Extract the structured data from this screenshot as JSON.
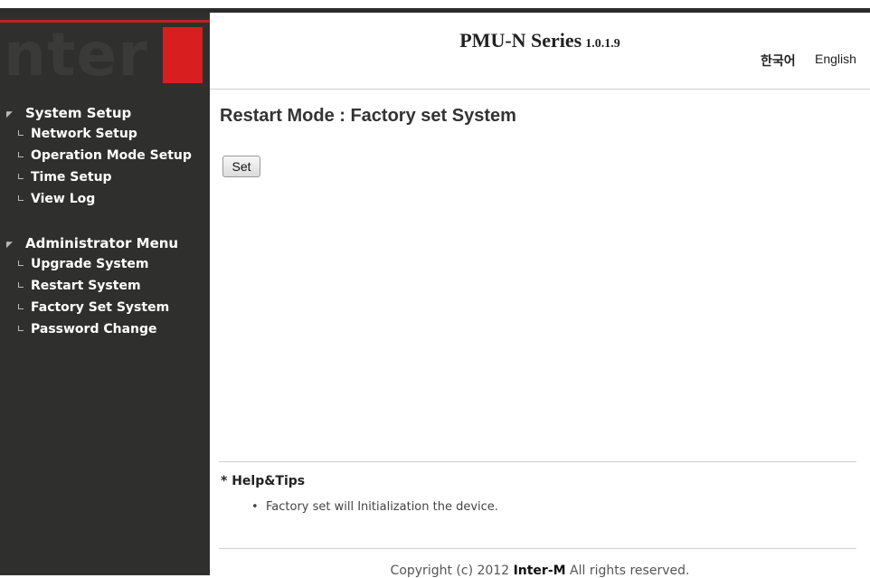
{
  "header": {
    "title": "PMU-N Series",
    "version": "1.0.1.9",
    "lang_ko": "한국어",
    "lang_en": "English"
  },
  "logo": {
    "text": "nter"
  },
  "sidebar": {
    "groups": [
      {
        "label": "System Setup",
        "items": [
          {
            "label": "Network Setup"
          },
          {
            "label": "Operation Mode Setup"
          },
          {
            "label": "Time Setup"
          },
          {
            "label": "View Log"
          }
        ]
      },
      {
        "label": "Administrator Menu",
        "items": [
          {
            "label": "Upgrade System"
          },
          {
            "label": "Restart System"
          },
          {
            "label": "Factory Set System"
          },
          {
            "label": "Password Change"
          }
        ]
      }
    ]
  },
  "main": {
    "title": "Restart Mode : Factory set System",
    "set_button": "Set"
  },
  "help": {
    "title": "* Help&Tips",
    "items": [
      {
        "text": "Factory set will Initialization the device."
      }
    ]
  },
  "footer": {
    "prefix": "Copyright (c) 2012 ",
    "brand": "Inter-M",
    "suffix": " All rights reserved."
  },
  "colors": {
    "sidebar_bg": "#2f302d",
    "logo_red": "#d81e1e"
  }
}
